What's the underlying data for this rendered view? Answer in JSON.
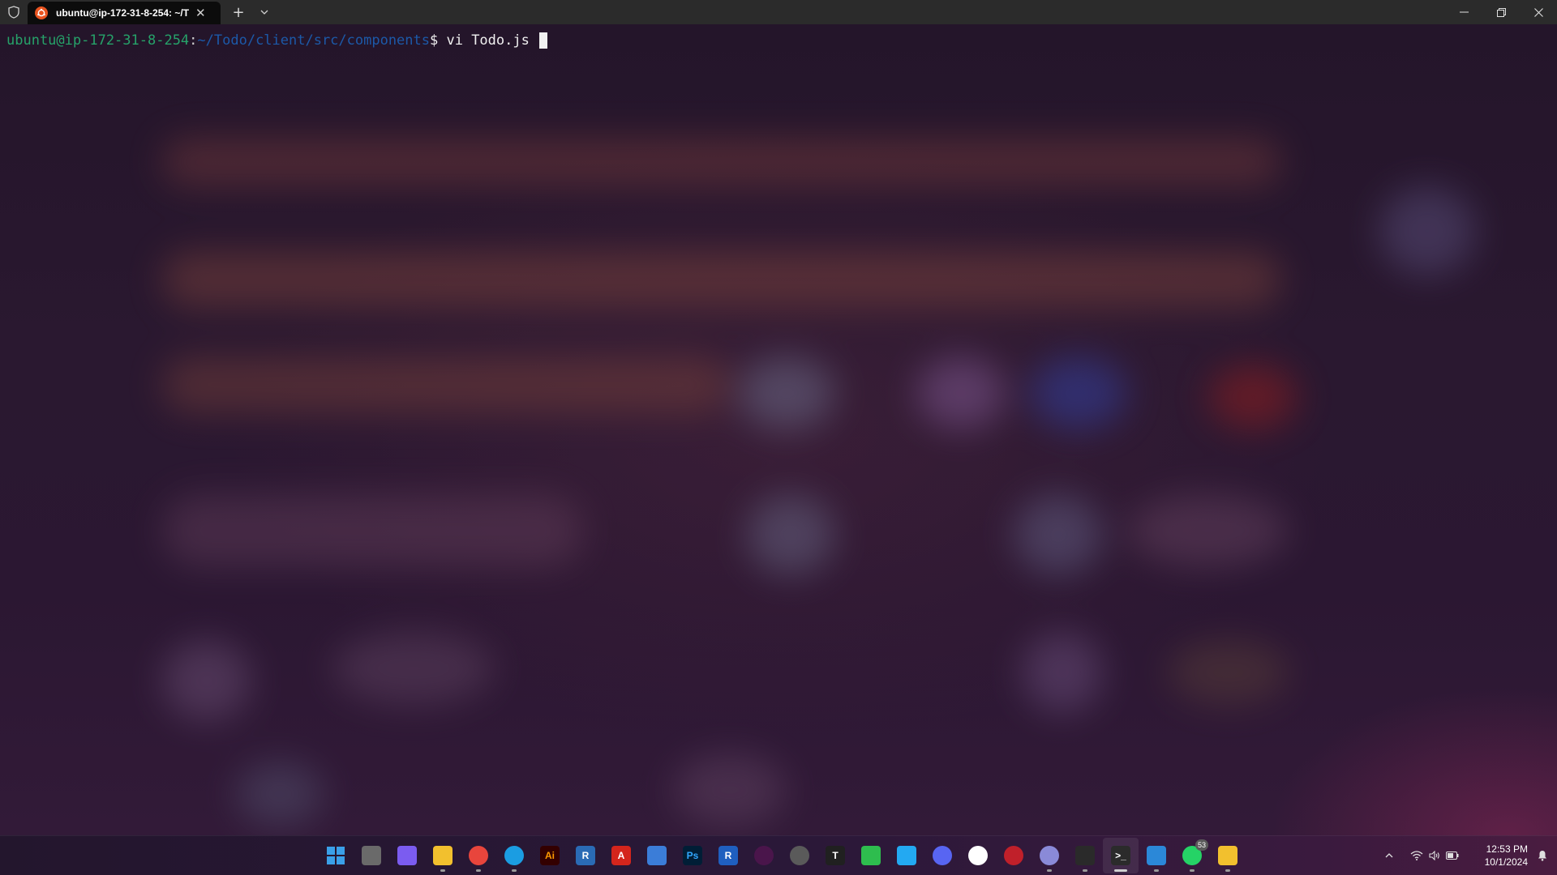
{
  "window": {
    "tab_title": "ubuntu@ip-172-31-8-254: ~/T",
    "tab_close": "✕",
    "new_tab": "+",
    "tab_dropdown_icon": "chevron-down-icon",
    "controls": [
      "minimize-icon",
      "restore-icon",
      "close-icon"
    ]
  },
  "terminal": {
    "user_host": "ubuntu@ip-172-31-8-254",
    "separator": ":",
    "path": "~/Todo/client/src/components",
    "prompt_symbol": "$ ",
    "command": "vi Todo.js ",
    "colors": {
      "user": "#26a269",
      "path": "#1c59a8",
      "text": "#f0f0f0"
    }
  },
  "taskbar": {
    "apps": [
      {
        "name": "start-icon",
        "label": "",
        "color": "#3aa0e8",
        "running": false
      },
      {
        "name": "task-view-icon",
        "label": "",
        "color": "#6a6a6a",
        "running": false
      },
      {
        "name": "copilot-icon",
        "label": "",
        "color": "#7b5cf0",
        "running": false
      },
      {
        "name": "file-explorer-icon",
        "label": "",
        "color": "#f2c02e",
        "running": true
      },
      {
        "name": "chrome-icon",
        "label": "",
        "color": "#e8453c",
        "running": true
      },
      {
        "name": "edge-icon",
        "label": "",
        "color": "#1b9de2",
        "running": true
      },
      {
        "name": "illustrator-icon",
        "label": "Ai",
        "color": "#330000",
        "running": false
      },
      {
        "name": "r-studio-icon",
        "label": "R",
        "color": "#2a6bb5",
        "running": false
      },
      {
        "name": "acrobat-icon",
        "label": "A",
        "color": "#d4251c",
        "running": false
      },
      {
        "name": "app-blue-shield-icon",
        "label": "",
        "color": "#3b7dd8",
        "running": false
      },
      {
        "name": "photoshop-icon",
        "label": "Ps",
        "color": "#001e36",
        "running": false
      },
      {
        "name": "r-app-icon",
        "label": "R",
        "color": "#1f5fbf",
        "running": false
      },
      {
        "name": "slack-icon",
        "label": "",
        "color": "#4a154b",
        "running": false
      },
      {
        "name": "app-circle-icon",
        "label": "",
        "color": "#5a5a5a",
        "running": false
      },
      {
        "name": "typora-icon",
        "label": "T",
        "color": "#202020",
        "running": false
      },
      {
        "name": "app-green-icon",
        "label": "",
        "color": "#2ebd4e",
        "running": false
      },
      {
        "name": "vscode-icon",
        "label": "",
        "color": "#23a9f2",
        "running": false
      },
      {
        "name": "discord-icon",
        "label": "",
        "color": "#5865f2",
        "running": false
      },
      {
        "name": "github-icon",
        "label": "",
        "color": "#ffffff",
        "running": false
      },
      {
        "name": "app-red-icon",
        "label": "",
        "color": "#c0202a",
        "running": false
      },
      {
        "name": "app-spiral-icon",
        "label": "",
        "color": "#8a8ad8",
        "running": true
      },
      {
        "name": "app-pen-icon",
        "label": "",
        "color": "#2a2a2a",
        "running": true
      },
      {
        "name": "terminal-icon",
        "label": ">_",
        "color": "#2b2b2b",
        "running": true,
        "active": true
      },
      {
        "name": "app-photos-icon",
        "label": "",
        "color": "#2b88d8",
        "running": true
      },
      {
        "name": "whatsapp-icon",
        "label": "",
        "color": "#25d366",
        "running": true,
        "badge": "53"
      },
      {
        "name": "app-yellow-folder-icon",
        "label": "",
        "color": "#f2c02e",
        "running": true
      }
    ],
    "tray": {
      "chevron_icon": "chevron-up-icon",
      "wifi_icon": "wifi-icon",
      "volume_icon": "volume-icon",
      "battery_icon": "battery-icon",
      "time": "12:53 PM",
      "date": "10/1/2024",
      "notification_icon": "bell-icon"
    }
  }
}
